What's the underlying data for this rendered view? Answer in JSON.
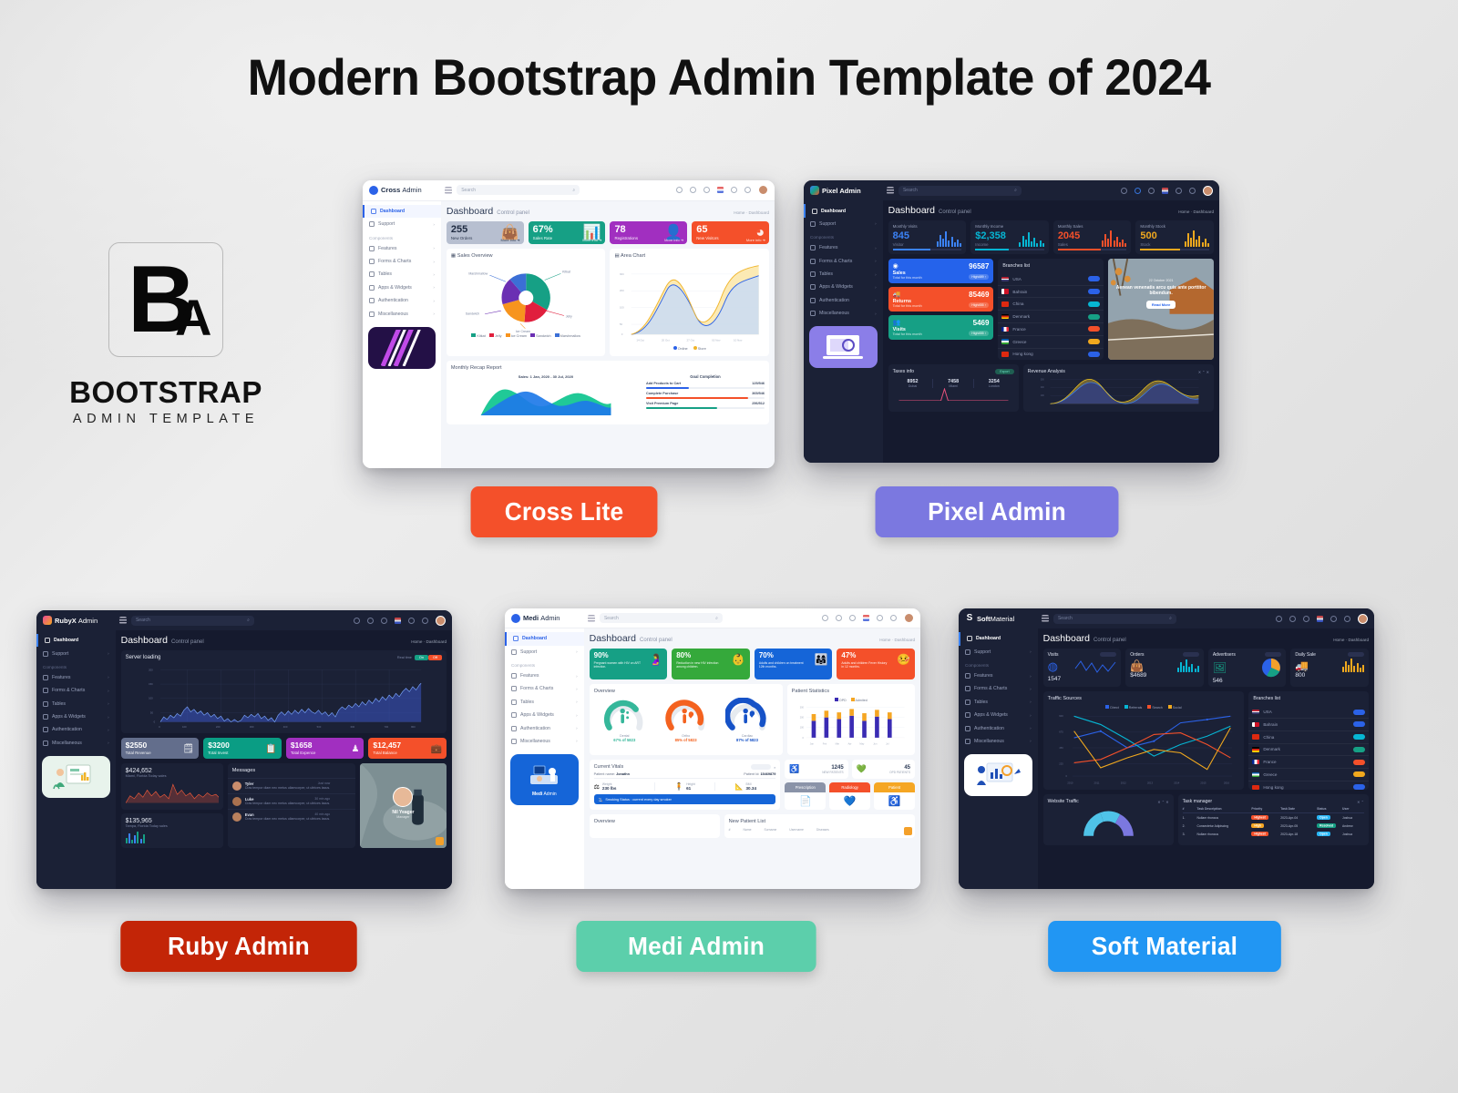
{
  "page": {
    "title": "Modern Bootstrap Admin Template of 2024",
    "background_accent": "#e6e6e6"
  },
  "brand": {
    "mark_primary": "B",
    "mark_secondary": "A",
    "name": "BOOTSTRAP",
    "tagline": "ADMIN TEMPLATE"
  },
  "templates": [
    {
      "id": "cross-lite",
      "badge_label": "Cross Lite",
      "badge_color": "#f4502a",
      "theme": "light",
      "app_name_bold": "Cross",
      "app_name_thin": "Admin",
      "logo_color": "#2b62e8",
      "search_placeholder": "Search",
      "page_title": "Dashboard",
      "page_subtitle": "Control panel",
      "breadcrumb": "Home  ·  Dashboard",
      "sidebar": [
        "Dashboard",
        "Support",
        "Components",
        "Features",
        "Forms & Charts",
        "Tables",
        "Apps & Widgets",
        "Authentication",
        "Miscellaneous"
      ],
      "stats": [
        {
          "value": "255",
          "label": "New Orders",
          "color": "#b7bfd0",
          "more": "More info ➜",
          "glyph": "👜"
        },
        {
          "value": "67%",
          "label": "Sales Rate",
          "color": "#16a085",
          "more": "More info ➜",
          "glyph": "📊"
        },
        {
          "value": "78",
          "label": "Registrations",
          "color": "#a12fc0",
          "more": "More info ➜",
          "glyph": "👤"
        },
        {
          "value": "65",
          "label": "New Visitors",
          "color": "#f4502a",
          "more": "More info ➜",
          "glyph": "◔"
        }
      ],
      "panels": {
        "left": "Sales Overview",
        "right": "Area Chart",
        "bottom": "Monthly Recap Report"
      },
      "donut_legend": [
        "Kitkat",
        "Jelly",
        "Ice Cream",
        "Sandwich",
        "Marshmallow"
      ],
      "area_legend": [
        "Online",
        "Store"
      ],
      "recap_caption": "Sales: 1 Jan, 2020 - 30 Jul, 2020",
      "goal_title": "Goal Completion",
      "goals": [
        {
          "label": "Add Products to Cart",
          "value": "125/546",
          "pct": 36,
          "color": "#2b62e8"
        },
        {
          "label": "Complete Purchase",
          "value": "365/546",
          "pct": 86,
          "color": "#f4502a"
        },
        {
          "label": "Visit Premium Page",
          "value": "256/512",
          "pct": 60,
          "color": "#16a085"
        }
      ]
    },
    {
      "id": "pixel-admin",
      "badge_label": "Pixel Admin",
      "badge_color": "#7b78e0",
      "theme": "dark",
      "app_name_bold": "Pixel",
      "app_name_thin": "Admin",
      "logo_color": "#3b82f6",
      "search_placeholder": "Search",
      "page_title": "Dashboard",
      "page_subtitle": "Control panel",
      "breadcrumb": "Home  ·  Dashboard",
      "sidebar": [
        "Dashboard",
        "Support",
        "Components",
        "Features",
        "Forms & Charts",
        "Tables",
        "Apps & Widgets",
        "Authentication",
        "Miscellaneous"
      ],
      "stats": [
        {
          "title": "Monthly Visits",
          "value": "845",
          "label": "Visitor",
          "color": "#3b82f6"
        },
        {
          "title": "Monthly Income",
          "value": "$2,358",
          "label": "Income",
          "color": "#06b6d4"
        },
        {
          "title": "Monthly Sales",
          "value": "2045",
          "label": "Sales",
          "color": "#f4502a"
        },
        {
          "title": "Monthly Stock",
          "value": "500",
          "label": "Stock",
          "color": "#f0a81e"
        }
      ],
      "tiles": [
        {
          "label": "Sales",
          "sub": "Total for this month",
          "value": "96587",
          "tag": "High489 ↑",
          "color": "#2563eb"
        },
        {
          "label": "Returns",
          "sub": "Total for this month",
          "value": "85469",
          "tag": "High455 ↑",
          "color": "#f4502a"
        },
        {
          "label": "Visits",
          "sub": "Total for this month",
          "value": "5469",
          "tag": "High455 ↑",
          "color": "#16a085"
        }
      ],
      "branches_title": "Branches list",
      "branches": [
        "USA",
        "Bahrain",
        "China",
        "Denmark",
        "France",
        "Greece",
        "Hong kong"
      ],
      "promo": {
        "date": "22 October 2021",
        "text": "Aenean venenatis arcu quis ante porttitor bibendum.",
        "button": "Read More"
      },
      "taxes_title": "Taxes info",
      "taxes_button": "Export",
      "taxes": [
        {
          "value": "8952",
          "label": "Dubai"
        },
        {
          "value": "7458",
          "label": "Miami"
        },
        {
          "value": "3254",
          "label": "London"
        }
      ],
      "revenue_title": "Revenue Analysis"
    },
    {
      "id": "ruby-admin",
      "badge_label": "Ruby Admin",
      "badge_color": "#c32507",
      "theme": "dark",
      "app_name_bold": "RubyX",
      "app_name_thin": "Admin",
      "logo_color": "#ec4899",
      "search_placeholder": "Search",
      "page_title": "Dashboard",
      "page_subtitle": "Control panel",
      "breadcrumb": "Home  ·  Dashboard",
      "sidebar": [
        "Dashboard",
        "Support",
        "Components",
        "Features",
        "Forms & Charts",
        "Tables",
        "Apps & Widgets",
        "Authentication",
        "Miscellaneous"
      ],
      "server_panel_title": "Server loading",
      "server_realtime_label": "Real time",
      "server_toggle": [
        "On",
        "Off"
      ],
      "server_yticks": [
        "200",
        "150",
        "100",
        "50",
        "0"
      ],
      "server_xticks": [
        "0",
        "100",
        "200",
        "300",
        "400",
        "500",
        "600",
        "700",
        "800",
        "900"
      ],
      "stats": [
        {
          "value": "$2550",
          "label": "Total Revenue",
          "color": "#636e8c",
          "glyph": "🗒"
        },
        {
          "value": "$3200",
          "label": "Total Invest",
          "color": "#0a9d84",
          "glyph": "📋"
        },
        {
          "value": "$1658",
          "label": "Total Expence",
          "color": "#a12fc0",
          "glyph": "♟"
        },
        {
          "value": "$12,457",
          "label": "Total Balance",
          "color": "#f4502a",
          "glyph": "💼"
        }
      ],
      "city_cards": [
        {
          "value": "$424,652",
          "label": "Miami, Florida Today sales"
        },
        {
          "value": "$135,965",
          "label": "Tampa, Florida Today sales"
        }
      ],
      "messages_title": "Messages",
      "messages": [
        {
          "name": "Tyler",
          "time": "Just now",
          "text": "Cras tempor diam nec metus ullamcorper, ut ultrices lacus."
        },
        {
          "name": "Luke",
          "time": "30 min ago",
          "text": "Cras tempor diam nec metus ullamcorper, ut ultrices lacus."
        },
        {
          "name": "Evan",
          "time": "40 min ago",
          "text": "Cras tempor diam nec metus ullamcorper, ut ultrices lacus."
        }
      ],
      "profile": {
        "name": "Nil Yeager",
        "role": "Manager"
      }
    },
    {
      "id": "medi-admin",
      "badge_label": "Medi Admin",
      "badge_color": "#5ccfab",
      "theme": "light",
      "app_name_bold": "Medi",
      "app_name_thin": "Admin",
      "logo_color": "#2b62e8",
      "search_placeholder": "Search",
      "page_title": "Dashboard",
      "page_subtitle": "Control panel",
      "breadcrumb": "Home  ·  Dashboard",
      "sidebar": [
        "Dashboard",
        "Support",
        "Components",
        "Features",
        "Forms & Charts",
        "Tables",
        "Apps & Widgets",
        "Authentication",
        "Miscellaneous"
      ],
      "promo_label_bold": "Medi",
      "promo_label_thin": "Admin",
      "stats": [
        {
          "value": "90%",
          "label": "Pregnant women with HIV on ART infection.",
          "color": "#16a085"
        },
        {
          "value": "80%",
          "label": "Reduction in new HIV infection among children.",
          "color": "#35a93b"
        },
        {
          "value": "70%",
          "label": "Adults and children on treatment 12th months.",
          "color": "#1565d8"
        },
        {
          "value": "47%",
          "label": "Adults and children Fever History in 12 months.",
          "color": "#f4502a"
        }
      ],
      "overview_title": "Overview",
      "gauges": [
        {
          "name": "Dental",
          "value": "67% of 5823",
          "pct": 67,
          "color": "#35b79a"
        },
        {
          "name": "Ortho",
          "value": "85% of 5823",
          "pct": 85,
          "color": "#f4621f"
        },
        {
          "name": "Cardiac",
          "value": "87% of 5823",
          "pct": 87,
          "color": "#1652c7"
        }
      ],
      "patient_stats_title": "Patient Statistics",
      "patient_stats_legend": [
        "OPD",
        "Admited"
      ],
      "patient_stats_months": [
        "Jan",
        "Feb",
        "Mar",
        "Apr",
        "May",
        "Jun",
        "Jul"
      ],
      "vitals_title": "Current Vitals",
      "vitals_patient_label": "Patient name:",
      "vitals_patient_name": "Jonathn",
      "vitals_id_label": "Patient Id:",
      "vitals_id": "15469879",
      "vitals": [
        {
          "label": "Weight",
          "value": "230 lbs"
        },
        {
          "label": "Height",
          "value": "61"
        },
        {
          "label": "BMI",
          "value": "30.34"
        }
      ],
      "smoking_status": "Smoking Status : current every day smoker",
      "counters": [
        {
          "value": "1245",
          "label": "NEW PATIENTS"
        },
        {
          "value": "45",
          "label": "OPD PATIENTS"
        }
      ],
      "actions": [
        {
          "label": "Prescription",
          "color": "#8a93a8"
        },
        {
          "label": "Radiology",
          "color": "#f4502a"
        },
        {
          "label": "Patient",
          "color": "#f5a623"
        }
      ],
      "bottom_left_title": "Overview",
      "bottom_right_title": "New Patient List",
      "patient_columns": [
        "#",
        "Name",
        "Surname",
        "Username",
        "Diseases"
      ]
    },
    {
      "id": "soft-material",
      "badge_label": "Soft Material",
      "badge_color": "#2196f3",
      "theme": "dark",
      "app_name_bold": "Soft",
      "app_name_thin": "Material",
      "logo_color": "#ffffff",
      "search_placeholder": "Search",
      "page_title": "Dashboard",
      "page_subtitle": "Control panel",
      "breadcrumb": "Home  ·  Dashboard",
      "sidebar": [
        "Dashboard",
        "Support",
        "Components",
        "Features",
        "Forms & Charts",
        "Tables",
        "Apps & Widgets",
        "Authentication",
        "Miscellaneous"
      ],
      "stats": [
        {
          "title": "Visits",
          "value": "1547",
          "color": "#2b62e8",
          "kind": "line"
        },
        {
          "title": "Orders",
          "value": "$4689",
          "color": "#06b6d4",
          "kind": "bars"
        },
        {
          "title": "Advertisers",
          "value": "546",
          "color": "#16a085",
          "kind": "pie"
        },
        {
          "title": "Daily Sale",
          "value": "800",
          "color": "#f0a81e",
          "kind": "bars"
        }
      ],
      "traffic_title": "Traffic Sources",
      "traffic_legend": [
        "Direct",
        "Referrals",
        "Search",
        "Social"
      ],
      "traffic_yticks": [
        "900",
        "675",
        "450",
        "225",
        "0"
      ],
      "traffic_xticks": [
        "2010",
        "2011",
        "2012",
        "2013",
        "2014",
        "2015",
        "2016"
      ],
      "branches_title": "Branches list",
      "branches": [
        "USA",
        "Bahrain",
        "China",
        "Denmark",
        "France",
        "Greece",
        "Hong kong"
      ],
      "website_traffic_title": "Website Traffic",
      "task_manager_title": "Task manager",
      "task_columns": [
        "#",
        "Task Description",
        "Priority",
        "Task Date",
        "Status",
        "User"
      ],
      "tasks": [
        {
          "num": "1.",
          "desc": "Nullam rhoncus",
          "priority": "Highest",
          "priority_color": "#f4502a",
          "date": "2023-Apr-04",
          "status": "Open",
          "status_color": "#29b6f6",
          "user": "Joshua"
        },
        {
          "num": "2.",
          "desc": "Consectetur Adipiscing",
          "priority": "High",
          "priority_color": "#f5a623",
          "date": "2023-Apr-05",
          "status": "Resolved",
          "status_color": "#16a085",
          "user": "Andrew"
        },
        {
          "num": "3.",
          "desc": "Nullam rhoncus",
          "priority": "Highest",
          "priority_color": "#f4502a",
          "date": "2023-Apr-18",
          "status": "Open",
          "status_color": "#29b6f6",
          "user": "Joshua"
        }
      ]
    }
  ]
}
